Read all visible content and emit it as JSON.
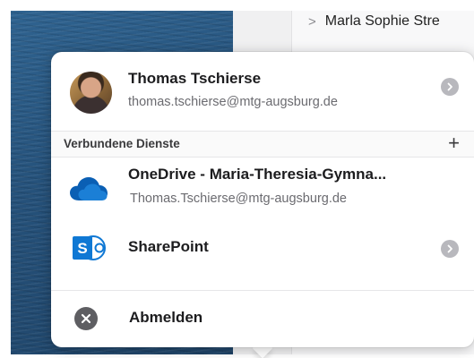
{
  "background": {
    "list_item_label": "Marla Sophie Stre"
  },
  "account": {
    "name": "Thomas Tschierse",
    "email": "thomas.tschierse@mtg-augsburg.de"
  },
  "connected_services": {
    "title": "Verbundene Dienste",
    "add_label": "+",
    "items": [
      {
        "title": "OneDrive - Maria-Theresia-Gymna...",
        "subtitle": "Thomas.Tschierse@mtg-augsburg.de",
        "icon": "onedrive-cloud-icon"
      },
      {
        "title": "SharePoint",
        "icon": "sharepoint-icon"
      }
    ]
  },
  "logout": {
    "label": "Abmelden",
    "icon": "close-circle-icon"
  },
  "colors": {
    "onedrive_blue": "#0a5fb4",
    "sharepoint_blue": "#0f78d4",
    "chevron_gray": "#b8b8bd",
    "logout_icon_gray": "#5e5e62"
  }
}
